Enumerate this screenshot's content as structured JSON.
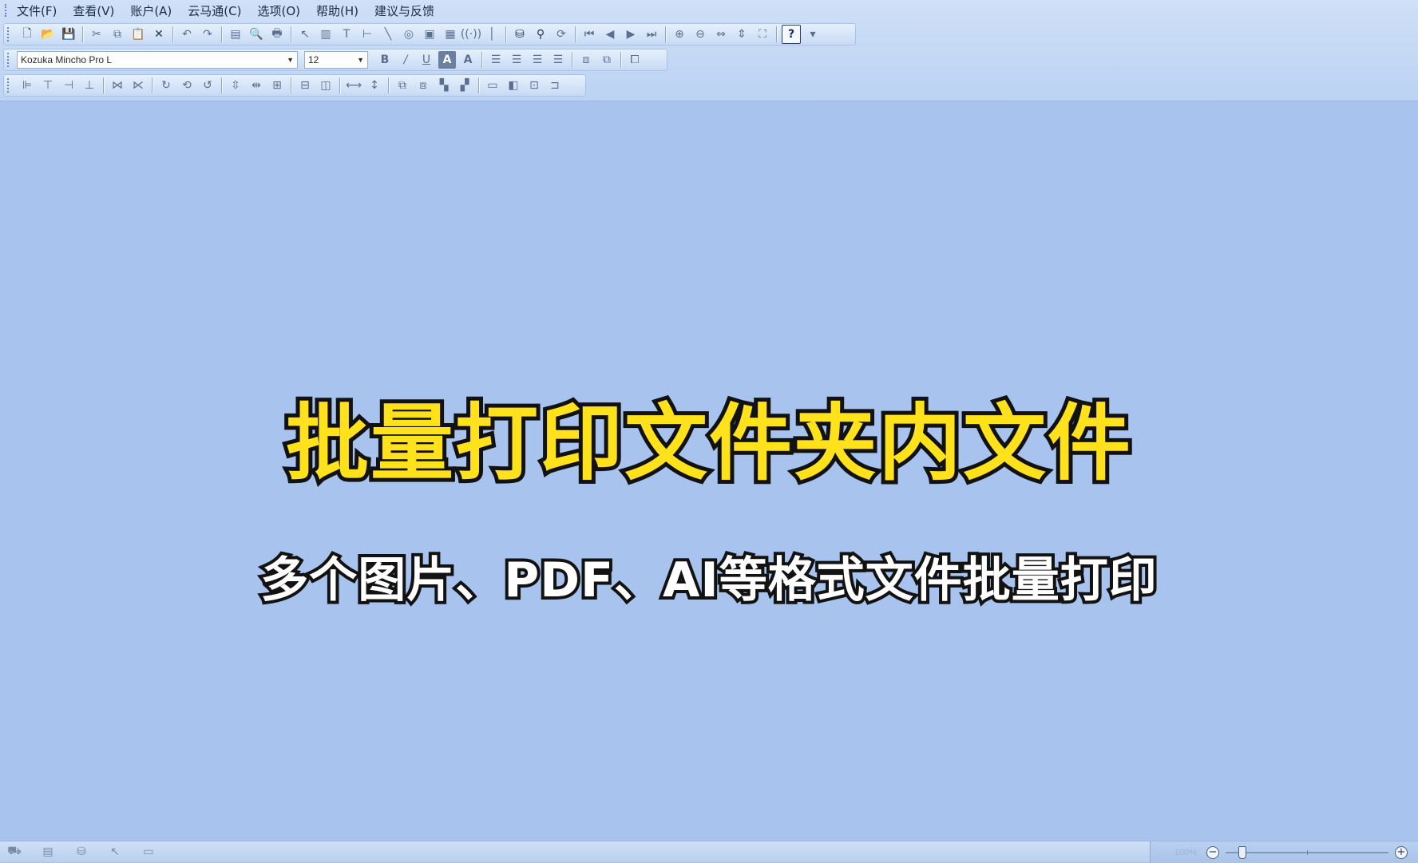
{
  "menu": [
    {
      "id": "file",
      "label": "文件(F)"
    },
    {
      "id": "view",
      "label": "查看(V)"
    },
    {
      "id": "account",
      "label": "账户(A)"
    },
    {
      "id": "cloud",
      "label": "云马通(C)"
    },
    {
      "id": "options",
      "label": "选项(O)"
    },
    {
      "id": "help",
      "label": "帮助(H)"
    },
    {
      "id": "feedback",
      "label": "建议与反馈"
    }
  ],
  "toolbar2": {
    "font_value": "Kozuka Mincho Pro L",
    "size_value": "12",
    "bold_glyph": "B",
    "italic_glyph": "/",
    "underline_glyph": "U",
    "highlight_glyph": "A",
    "fontcolor_glyph": "A"
  },
  "canvas": {
    "title": "批量打印文件夹内文件",
    "subtitle": "多个图片、PDF、AI等格式文件批量打印"
  },
  "status": {
    "zoom_label": "100%",
    "zoom_fraction": 0.08
  },
  "colors": {
    "canvas_bg": "#a7c3ee",
    "title_fill": "#ffe21c",
    "subtitle_fill": "#ffffff",
    "text_stroke": "#121212"
  },
  "icons": {
    "toolbar1": [
      "new-file-icon",
      "open-folder-icon",
      "save-icon",
      "cut-icon",
      "copy-icon",
      "paste-icon",
      "delete-icon",
      "undo-icon",
      "redo-icon",
      "page-setup-icon",
      "print-preview-icon",
      "print-icon",
      "select-pointer-icon",
      "barcode-icon",
      "text-icon",
      "line-icon",
      "diagonal-line-icon",
      "shape-icon",
      "image-icon",
      "table-icon",
      "rfid-icon",
      "vertical-line-icon",
      "database-icon",
      "search-icon",
      "refresh-icon",
      "first-page-icon",
      "prev-page-icon",
      "next-page-icon",
      "last-page-icon",
      "zoom-in-icon",
      "zoom-out-icon",
      "fit-width-icon",
      "fit-height-icon",
      "fit-page-icon",
      "help-icon"
    ]
  }
}
